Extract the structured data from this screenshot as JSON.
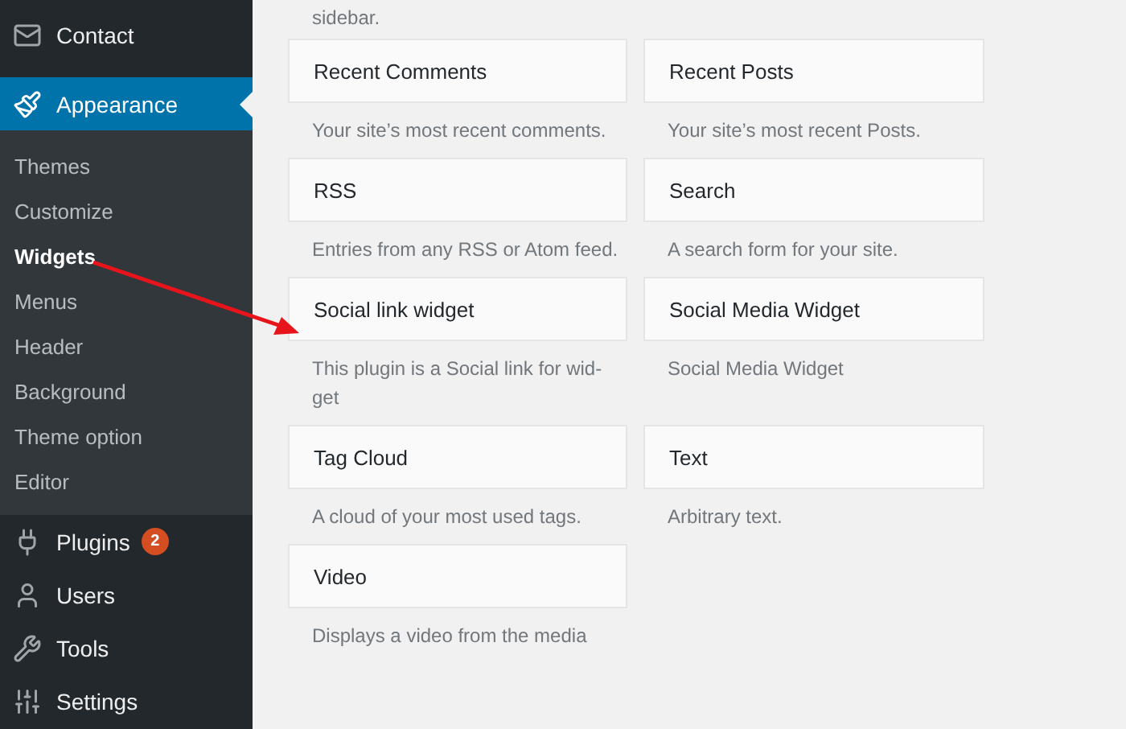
{
  "sidebar": {
    "items": [
      {
        "label": "Contact",
        "selected": false
      },
      {
        "label": "Appearance",
        "selected": true,
        "submenu": [
          {
            "label": "Themes",
            "selected": false
          },
          {
            "label": "Customize",
            "selected": false
          },
          {
            "label": "Widgets",
            "selected": true
          },
          {
            "label": "Menus",
            "selected": false
          },
          {
            "label": "Header",
            "selected": false
          },
          {
            "label": "Background",
            "selected": false
          },
          {
            "label": "Theme option",
            "selected": false
          },
          {
            "label": "Editor",
            "selected": false
          }
        ]
      },
      {
        "label": "Plugins",
        "selected": false,
        "badge": "2"
      },
      {
        "label": "Users",
        "selected": false
      },
      {
        "label": "Tools",
        "selected": false
      },
      {
        "label": "Settings",
        "selected": false
      }
    ]
  },
  "intro_text": "sidebar.",
  "widgets": [
    {
      "title": "Recent Comments",
      "description": "Your site’s most recent comments."
    },
    {
      "title": "Recent Posts",
      "description": "Your site’s most recent Posts."
    },
    {
      "title": "RSS",
      "description": "Entries from any RSS or Atom feed."
    },
    {
      "title": "Search",
      "description": "A search form for your site."
    },
    {
      "title": "Social link widget",
      "description": "This plugin is a Social link for wid-get"
    },
    {
      "title": "Social Media Widget",
      "description": "Social Media Widget"
    },
    {
      "title": "Tag Cloud",
      "description": "A cloud of your most used tags."
    },
    {
      "title": "Text",
      "description": "Arbitrary text."
    },
    {
      "title": "Video",
      "description": "Displays a video from the media"
    }
  ]
}
